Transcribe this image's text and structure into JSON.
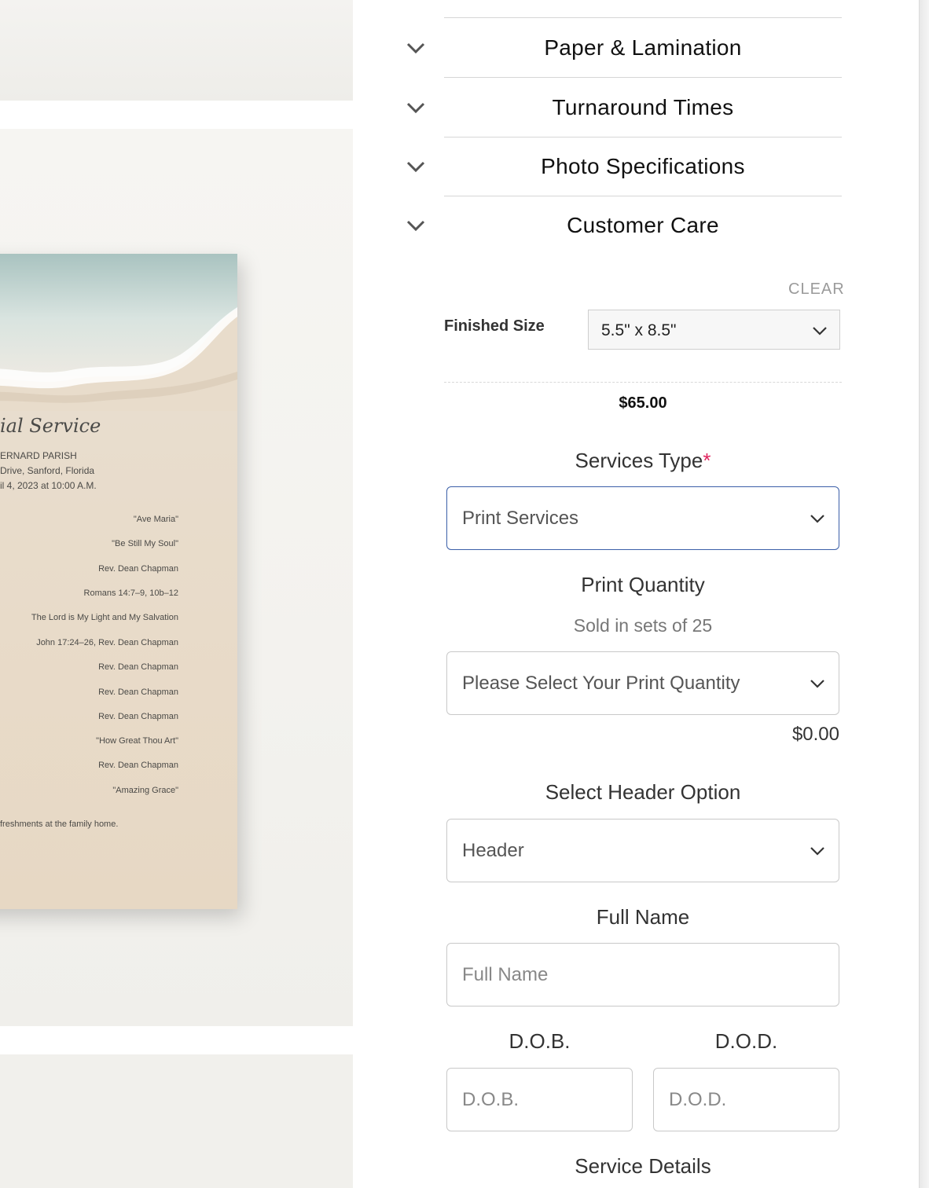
{
  "preview": {
    "card_title": "ial Service",
    "church": "ERNARD PARISH",
    "address": " Drive, Sanford, Florida",
    "date": "il 4, 2023 at 10:00 A.M.",
    "program": [
      "\"Ave Maria\"",
      "\"Be Still My Soul\"",
      "Rev. Dean Chapman",
      "Romans 14:7–9, 10b–12",
      "The Lord is My Light and My Salvation",
      "John 17:24–26, Rev. Dean Chapman",
      "Rev. Dean Chapman",
      "Rev. Dean Chapman",
      "Rev. Dean Chapman",
      "\"How Great Thou Art\"",
      "Rev. Dean Chapman",
      "\"Amazing Grace\""
    ],
    "footer": "freshments at the family home."
  },
  "accordion": [
    {
      "label": "Paper & Lamination"
    },
    {
      "label": "Turnaround Times"
    },
    {
      "label": "Photo Specifications"
    },
    {
      "label": "Customer Care"
    }
  ],
  "options": {
    "clear_label": "CLEAR",
    "finished_size_label": "Finished Size",
    "finished_size_value": "5.5\" x 8.5\"",
    "base_price": "$65.00"
  },
  "form": {
    "services_type_label": "Services Type",
    "required_mark": "*",
    "services_type_value": "Print Services",
    "print_quantity_label": "Print Quantity",
    "print_quantity_note": "Sold in sets of 25",
    "print_quantity_value": "Please Select Your Print Quantity",
    "print_quantity_price": "$0.00",
    "header_option_label": "Select Header Option",
    "header_option_value": "Header",
    "full_name_label": "Full Name",
    "full_name_placeholder": "Full Name",
    "dob_label": "D.O.B.",
    "dob_placeholder": "D.O.B.",
    "dod_label": "D.O.D.",
    "dod_placeholder": "D.O.D.",
    "service_details_label": "Service Details"
  },
  "icons": {
    "accordion_chevron": "chevron-down-icon",
    "select_chevron": "chevron-down-icon"
  },
  "colors": {
    "active_border": "#3b5fa8",
    "required": "#e0245e"
  }
}
